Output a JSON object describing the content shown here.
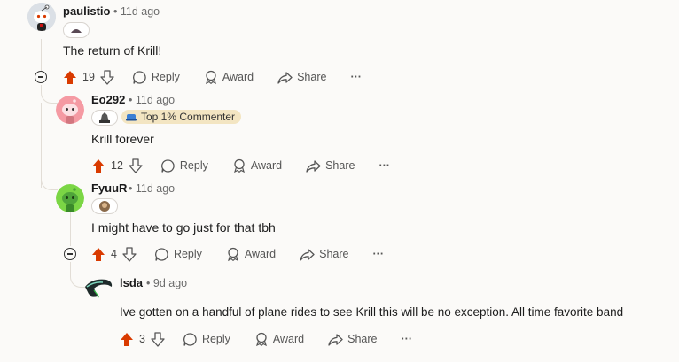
{
  "colors": {
    "upvote": "#d93a00",
    "badge_bg": "#f3e5c2",
    "line": "#e2ddd6"
  },
  "comments": [
    {
      "username": "paulistio",
      "time": "11d ago",
      "text": "The return of Krill!",
      "votes": "19",
      "avatar_icon": "snoo-avatar-icon",
      "flair_icon": "flair-emoji-icon"
    },
    {
      "username": "Eo292",
      "time": "11d ago",
      "badge": "Top 1% Commenter",
      "text": "Krill forever",
      "votes": "12",
      "avatar_icon": "snoo-avatar-icon",
      "flair_icon": "flair-emoji-icon"
    },
    {
      "username": "FyuuR",
      "time": "11d ago",
      "text": "I might have to go just for that tbh",
      "votes": "4",
      "avatar_icon": "snoo-avatar-icon",
      "flair_icon": "flair-emoji-icon"
    },
    {
      "username": "lsda",
      "time": "9d ago",
      "text": "Ive gotten on a handful of plane rides to see Krill this will be no exception. All time favorite band",
      "votes": "3",
      "avatar_icon": "custom-avatar-icon"
    }
  ],
  "actions": {
    "reply": "Reply",
    "award": "Award",
    "share": "Share",
    "more": "···"
  },
  "separator": "•"
}
